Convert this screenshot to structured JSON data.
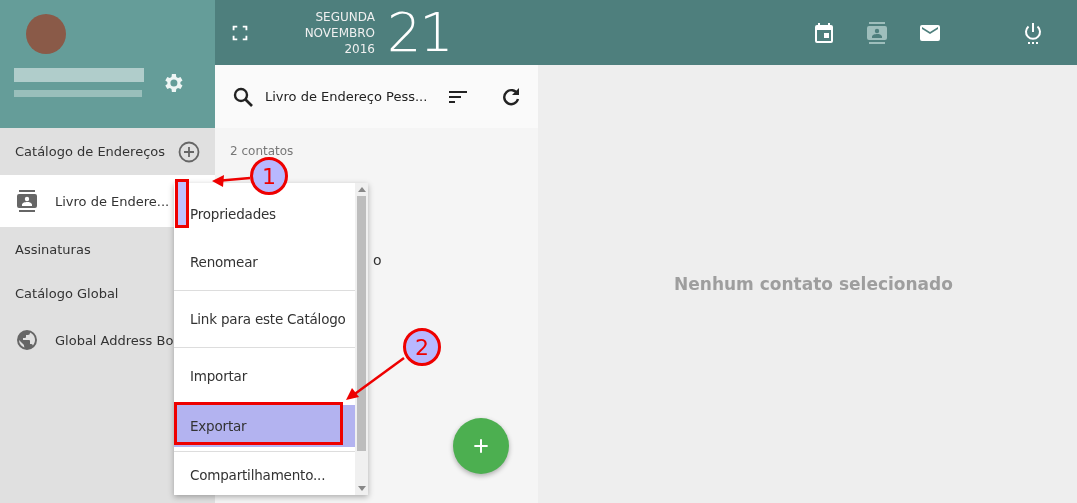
{
  "header": {
    "date": {
      "weekday": "SEGUNDA",
      "month": "NOVEMBRO",
      "year": "2016",
      "day": "21"
    },
    "apps": [
      {
        "kind": "calendar",
        "selected": false
      },
      {
        "kind": "contacts",
        "selected": true
      },
      {
        "kind": "mail",
        "selected": false
      }
    ]
  },
  "sidebar": {
    "section": "Catálogo de Endereços",
    "items": [
      {
        "kind": "book",
        "label": "Livro de Endere...",
        "selected": true
      },
      {
        "kind": "heading",
        "label": "Assinaturas",
        "selected": false
      },
      {
        "kind": "heading",
        "label": "Catálogo Global",
        "selected": false
      },
      {
        "kind": "globe",
        "label": "Global Address Bo",
        "selected": false
      }
    ]
  },
  "list": {
    "title": "Livro de Endereço Pess...",
    "count": "2 contatos",
    "contacts": [
      {
        "name": "o"
      }
    ]
  },
  "detail": {
    "empty_text": "Nenhum contato selecionado"
  },
  "menu": {
    "items": [
      {
        "label": "Propriedades",
        "highlighted": false,
        "divider_after": false
      },
      {
        "label": "Renomear",
        "highlighted": false,
        "divider_after": true
      },
      {
        "label": "Link para este Catálogo",
        "highlighted": false,
        "divider_after": true
      },
      {
        "label": "Importar",
        "highlighted": false,
        "divider_after": false
      },
      {
        "label": "Exportar",
        "highlighted": true,
        "divider_after": true
      },
      {
        "label": "Compartilhamento...",
        "highlighted": false,
        "divider_after": false
      }
    ]
  },
  "annotations": [
    {
      "label": "1"
    },
    {
      "label": "2"
    }
  ]
}
